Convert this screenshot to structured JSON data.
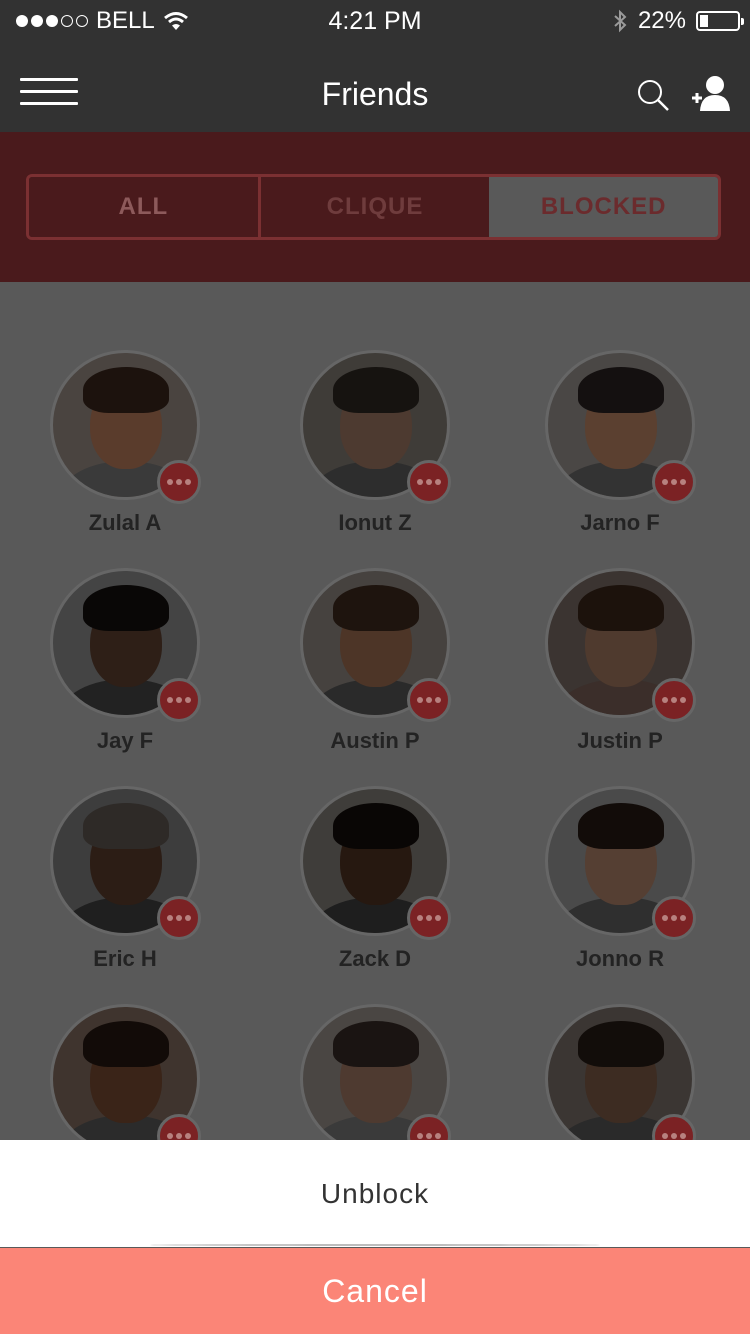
{
  "status_bar": {
    "carrier": "BELL",
    "time": "4:21 PM",
    "battery": "22%",
    "battery_level": 0.22,
    "signal_icon": "signal-dots-icon",
    "wifi_icon": "wifi-icon",
    "bluetooth_icon": "bluetooth-icon"
  },
  "nav": {
    "title": "Friends",
    "menu_icon": "hamburger-menu-icon",
    "search_icon": "search-icon",
    "add_icon": "add-friend-icon"
  },
  "tabs": {
    "all": "ALL",
    "clique": "CLIQUE",
    "blocked": "BLOCKED",
    "selected": "BLOCKED"
  },
  "friends": [
    {
      "name": "Zulal A"
    },
    {
      "name": "Ionut Z"
    },
    {
      "name": "Jarno F"
    },
    {
      "name": "Jay F"
    },
    {
      "name": "Austin P"
    },
    {
      "name": "Justin P"
    },
    {
      "name": "Eric H"
    },
    {
      "name": "Zack D"
    },
    {
      "name": "Jonno R"
    },
    {
      "name": ""
    },
    {
      "name": ""
    },
    {
      "name": ""
    }
  ],
  "action_sheet": {
    "option": "Unblock",
    "cancel": "Cancel"
  },
  "colors": {
    "bar": "#323232",
    "accent": "#fb8577",
    "band": "#4a1a1c",
    "badge": "#7b2224"
  }
}
